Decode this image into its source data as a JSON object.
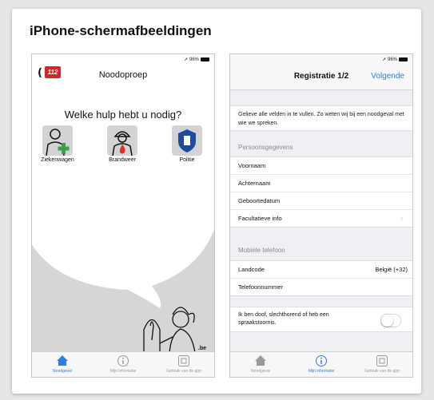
{
  "page": {
    "heading": "iPhone-schermafbeeldingen"
  },
  "status": {
    "text": "➚ 96%"
  },
  "phone1": {
    "logo_text": "112",
    "title": "Noodoproep",
    "question": "Welke hulp hebt u nodig?",
    "services": [
      {
        "label": "Ziekenwagen",
        "icon": "ambulance-person-icon"
      },
      {
        "label": "Brandweer",
        "icon": "firefighter-icon"
      },
      {
        "label": "Politie",
        "icon": "police-badge-icon"
      }
    ],
    "brand": ".be",
    "tabs": [
      {
        "label": "Noodgeval",
        "icon": "house-icon",
        "active": true
      },
      {
        "label": "Mijn informatie",
        "icon": "info-icon",
        "active": false
      },
      {
        "label": "Gebruik van de app",
        "icon": "phone-usage-icon",
        "active": false
      }
    ]
  },
  "phone2": {
    "title": "Registratie 1/2",
    "next": "Volgende",
    "intro": "Gelieve alle velden in te vullen. Zo weten wij bij een noodgeval met wie we spreken.",
    "personal_header": "Persoonsgegevens",
    "personal_fields": [
      "Voornaam",
      "Achternaam",
      "Geboortedatum",
      "Facultatieve info"
    ],
    "mobile_header": "Mobiele telefoon",
    "country_label": "Landcode",
    "country_value": "België (+32)",
    "phone_label": "Telefoonnummer",
    "deaf_text": "Ik ben doof, slechthorend of heb een spraakstoornis.",
    "deaf_toggle": false,
    "tabs": [
      {
        "label": "Noodgeval",
        "icon": "house-icon",
        "active": false
      },
      {
        "label": "Mijn informatie",
        "icon": "info-icon",
        "active": true
      },
      {
        "label": "Gebruik van de app",
        "icon": "phone-usage-icon",
        "active": false
      }
    ]
  },
  "colors": {
    "accent": "#2f7ee6",
    "logo_red": "#d8232a",
    "fire_red": "#e0302a",
    "police_blue": "#1e4b9b",
    "ambulance_green": "#3aa14a"
  }
}
